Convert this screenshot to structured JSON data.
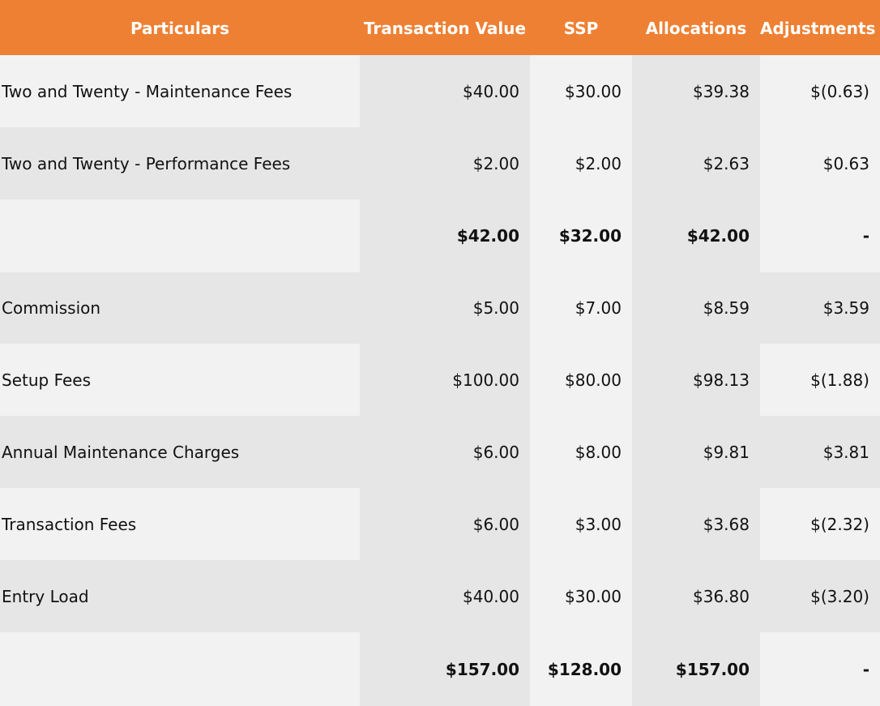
{
  "headers": [
    "Particulars",
    "Transaction Value",
    "SSP",
    "Allocations",
    "Adjustments"
  ],
  "rows": [
    {
      "particulars": "Two and Twenty - Maintenance Fees",
      "transaction_value": "$40.00",
      "ssp": "$30.00",
      "allocations": "$39.38",
      "adjustments": "$(0.63)"
    },
    {
      "particulars": "Two and Twenty - Performance Fees",
      "transaction_value": "$2.00",
      "ssp": "$2.00",
      "allocations": "$2.63",
      "adjustments": "$0.63"
    },
    {
      "particulars": "",
      "transaction_value": "$42.00",
      "ssp": "$32.00",
      "allocations": "$42.00",
      "adjustments": "-"
    },
    {
      "particulars": "Commission",
      "transaction_value": "$5.00",
      "ssp": "$7.00",
      "allocations": "$8.59",
      "adjustments": "$3.59"
    },
    {
      "particulars": "Setup Fees",
      "transaction_value": "$100.00",
      "ssp": "$80.00",
      "allocations": "$98.13",
      "adjustments": "$(1.88)"
    },
    {
      "particulars": "Annual Maintenance Charges",
      "transaction_value": "$6.00",
      "ssp": "$8.00",
      "allocations": "$9.81",
      "adjustments": "$3.81"
    },
    {
      "particulars": "Transaction Fees",
      "transaction_value": "$6.00",
      "ssp": "$3.00",
      "allocations": "$3.68",
      "adjustments": "$(2.32)"
    },
    {
      "particulars": "Entry Load",
      "transaction_value": "$40.00",
      "ssp": "$30.00",
      "allocations": "$36.80",
      "adjustments": "$(3.20)"
    },
    {
      "particulars": "",
      "transaction_value": "$157.00",
      "ssp": "$128.00",
      "allocations": "$157.00",
      "adjustments": "-"
    }
  ]
}
